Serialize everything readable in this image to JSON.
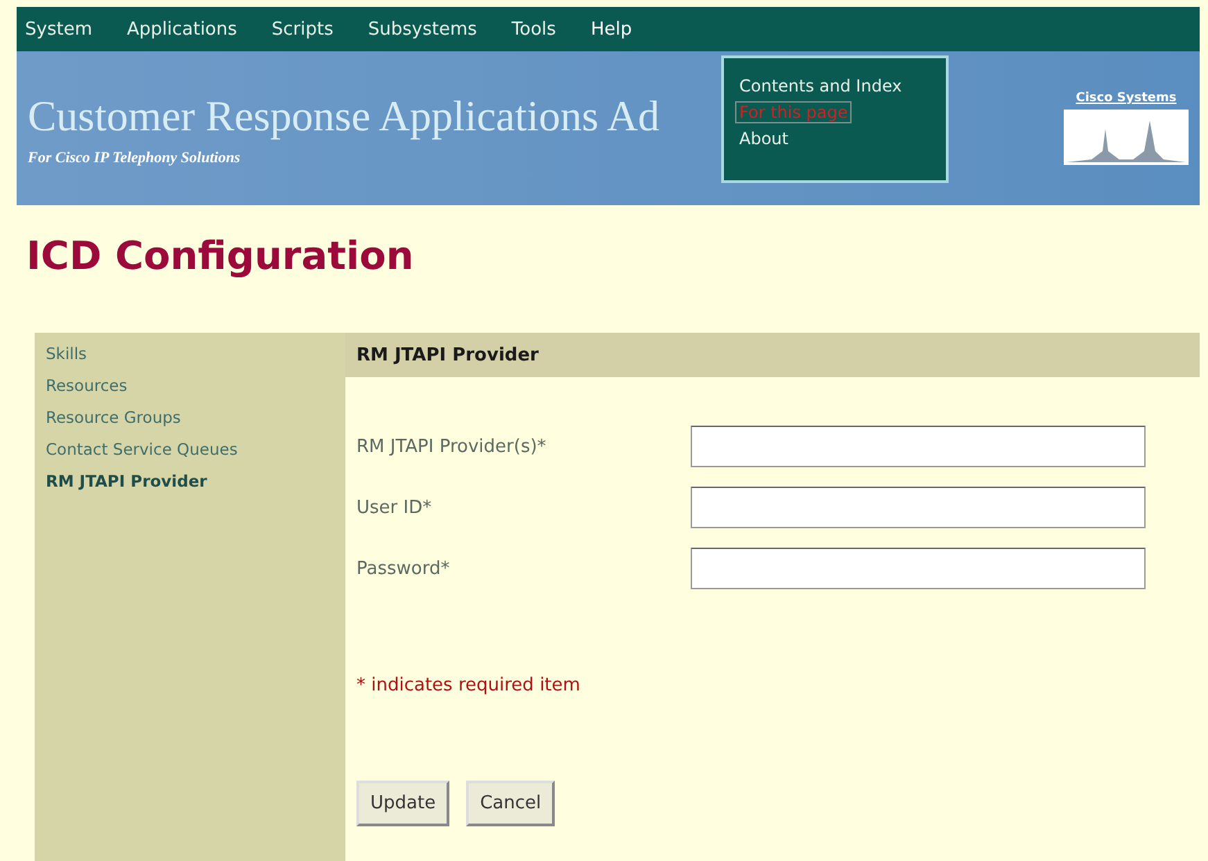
{
  "menu_bar": {
    "items": [
      {
        "label": "System"
      },
      {
        "label": "Applications"
      },
      {
        "label": "Scripts"
      },
      {
        "label": "Subsystems"
      },
      {
        "label": "Tools"
      },
      {
        "label": "Help",
        "open": true
      }
    ]
  },
  "help_menu": {
    "items": [
      {
        "label": "Contents and Index",
        "selected": false
      },
      {
        "label": "For this page",
        "selected": true
      },
      {
        "label": "About",
        "selected": false
      }
    ]
  },
  "banner": {
    "title": "Customer Response Applications Ad",
    "subtitle": "For Cisco IP Telephony Solutions",
    "logo": "Cisco Systems"
  },
  "page_title": "ICD Configuration",
  "sidebar": {
    "items": [
      {
        "label": "Skills",
        "selected": false
      },
      {
        "label": "Resources",
        "selected": false
      },
      {
        "label": "Resource Groups",
        "selected": false
      },
      {
        "label": "Contact Service Queues",
        "selected": false
      },
      {
        "label": "RM JTAPI Provider",
        "selected": true
      }
    ]
  },
  "form": {
    "heading": "RM JTAPI Provider",
    "fields": [
      {
        "label": "RM JTAPI Provider(s)*"
      },
      {
        "label": "User ID*"
      },
      {
        "label": "Password*"
      }
    ],
    "note": "* indicates required item",
    "buttons": [
      "Update",
      "Cancel"
    ]
  }
}
